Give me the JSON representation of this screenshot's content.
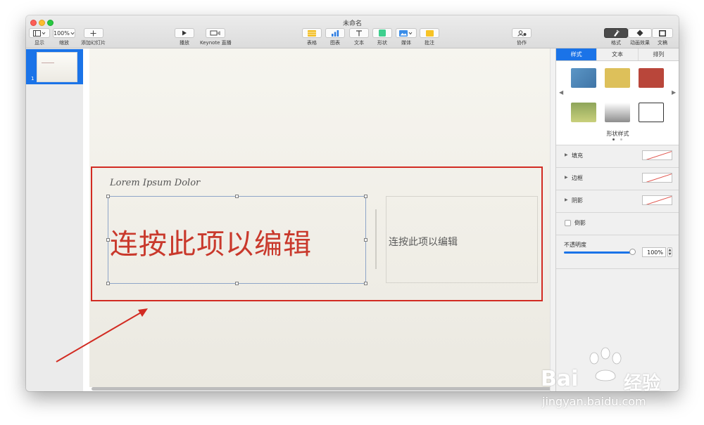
{
  "window": {
    "title": "未命名"
  },
  "toolbar": {
    "view": {
      "label": "显示"
    },
    "zoom": {
      "value": "100%",
      "label": "缩放"
    },
    "add_slide": {
      "label": "添加幻灯片"
    },
    "play": {
      "label": "播放"
    },
    "keynote_live": {
      "label": "Keynote 直播"
    },
    "table": {
      "label": "表格"
    },
    "chart": {
      "label": "图表"
    },
    "text": {
      "label": "文本"
    },
    "shape": {
      "label": "形状"
    },
    "media": {
      "label": "媒体"
    },
    "comment": {
      "label": "批注"
    },
    "collaborate": {
      "label": "协作"
    },
    "format": {
      "label": "格式"
    },
    "animate": {
      "label": "动画效果"
    },
    "document": {
      "label": "文稿"
    }
  },
  "navigator": {
    "slides": [
      {
        "number": "1",
        "selected": true
      }
    ]
  },
  "slide": {
    "title_text": "Lorem Ipsum Dolor",
    "main_placeholder": "连按此项以编辑",
    "side_placeholder": "连按此项以编辑"
  },
  "inspector": {
    "tabs": [
      {
        "label": "样式",
        "active": true
      },
      {
        "label": "文本",
        "active": false
      },
      {
        "label": "排列",
        "active": false
      }
    ],
    "shape_styles_label": "形状样式",
    "style_swatches": [
      {
        "name": "blue-texture",
        "color": "#4a86b8"
      },
      {
        "name": "gold",
        "color": "#ddc05a"
      },
      {
        "name": "red",
        "color": "#b9463a"
      },
      {
        "name": "olive-gradient",
        "color": "#8ea55a"
      },
      {
        "name": "gray-gradient",
        "color": "#b3b3b3"
      },
      {
        "name": "white-outline",
        "color": "#ffffff"
      }
    ],
    "properties": [
      {
        "label": "填充"
      },
      {
        "label": "边框"
      },
      {
        "label": "阴影"
      }
    ],
    "reflection_label": "倒影",
    "opacity": {
      "label": "不透明度",
      "value": "100%",
      "fraction": 1.0
    }
  },
  "watermark": {
    "brand": "Bai",
    "brand_suffix": "经验",
    "url": "jingyan.baidu.com"
  },
  "colors": {
    "accent": "#1a73e8",
    "annotation_red": "#d22b22",
    "title_red": "#c9392c"
  }
}
